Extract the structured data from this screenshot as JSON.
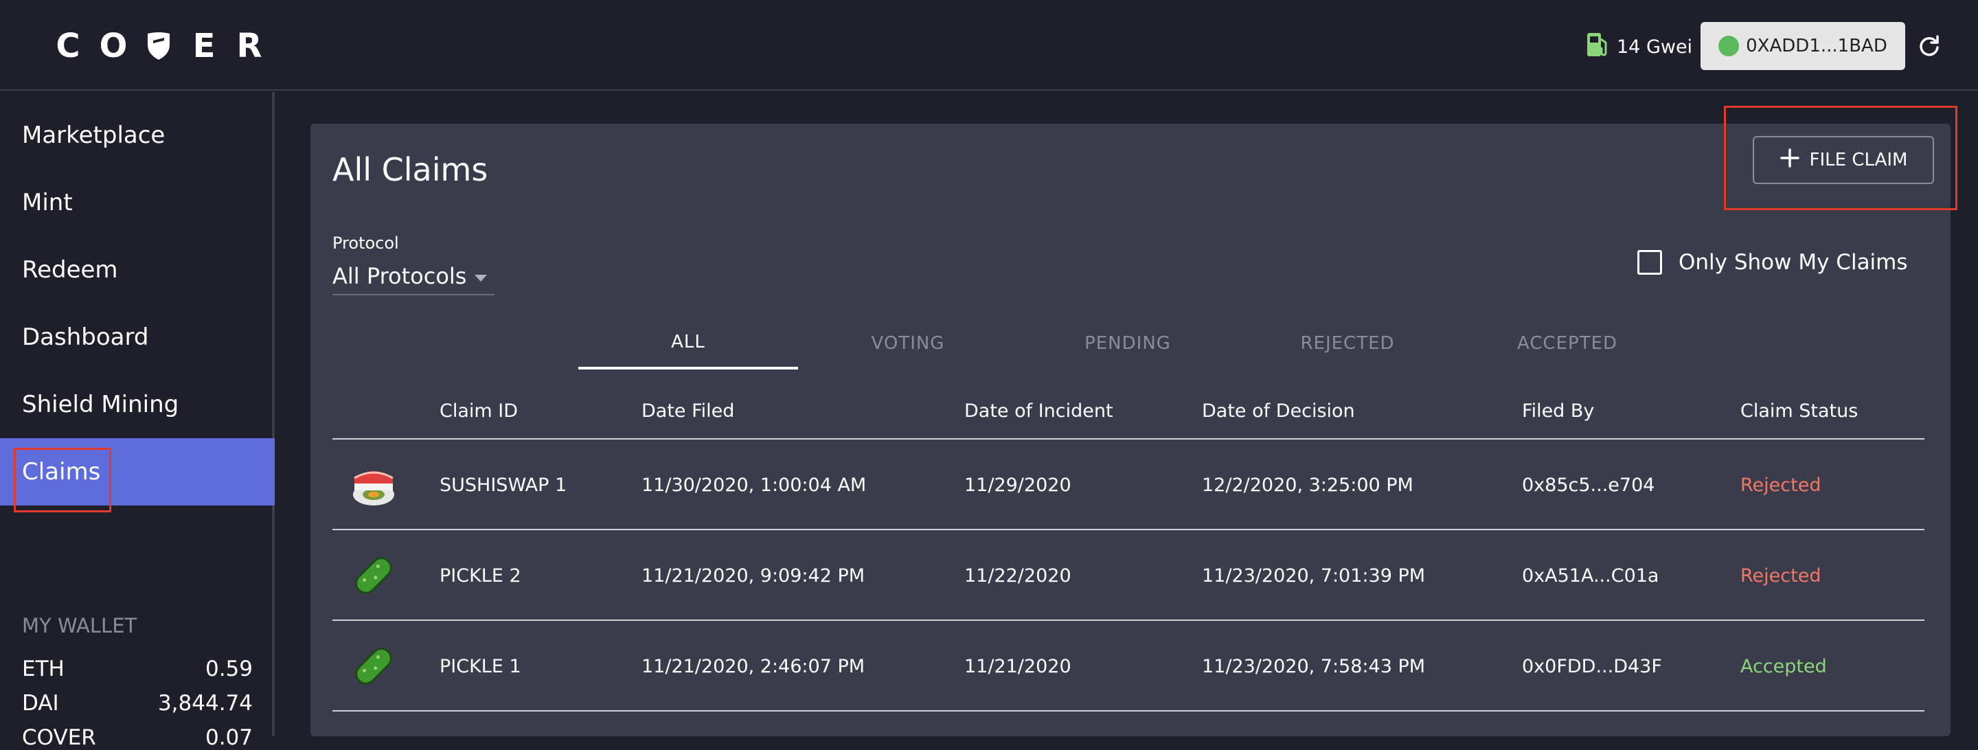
{
  "header": {
    "logo_letters": [
      "C",
      "O",
      "E",
      "R"
    ],
    "gas_value": "14 Gwei",
    "wallet_address": "0XADD1...1BAD"
  },
  "sidebar": {
    "items": [
      {
        "label": "Marketplace"
      },
      {
        "label": "Mint"
      },
      {
        "label": "Redeem"
      },
      {
        "label": "Dashboard"
      },
      {
        "label": "Shield Mining"
      },
      {
        "label": "Claims",
        "active": true
      }
    ],
    "wallet": {
      "title": "MY WALLET",
      "balances": [
        {
          "token": "ETH",
          "amount": "0.59"
        },
        {
          "token": "DAI",
          "amount": "3,844.74"
        },
        {
          "token": "COVER",
          "amount": "0.07"
        }
      ]
    }
  },
  "main": {
    "title": "All Claims",
    "file_claim_label": "FILE CLAIM",
    "protocol_label": "Protocol",
    "protocol_value": "All Protocols",
    "only_mine_label": "Only Show My Claims",
    "tabs": [
      {
        "label": "ALL",
        "active": true
      },
      {
        "label": "VOTING"
      },
      {
        "label": "PENDING"
      },
      {
        "label": "REJECTED"
      },
      {
        "label": "ACCEPTED"
      }
    ],
    "columns": [
      "Claim ID",
      "Date Filed",
      "Date of Incident",
      "Date of Decision",
      "Filed By",
      "Claim Status"
    ],
    "rows": [
      {
        "icon": "sushi-icon",
        "claim_id": "SUSHISWAP 1",
        "date_filed": "11/30/2020, 1:00:04 AM",
        "date_incident": "11/29/2020",
        "date_decision": "12/2/2020, 3:25:00 PM",
        "filed_by": "0x85c5...e704",
        "status": "Rejected"
      },
      {
        "icon": "pickle-icon",
        "claim_id": "PICKLE 2",
        "date_filed": "11/21/2020, 9:09:42 PM",
        "date_incident": "11/22/2020",
        "date_decision": "11/23/2020, 7:01:39 PM",
        "filed_by": "0xA51A...C01a",
        "status": "Rejected"
      },
      {
        "icon": "pickle-icon",
        "claim_id": "PICKLE 1",
        "date_filed": "11/21/2020, 2:46:07 PM",
        "date_incident": "11/21/2020",
        "date_decision": "11/23/2020, 7:58:43 PM",
        "filed_by": "0x0FDD...D43F",
        "status": "Accepted"
      }
    ]
  },
  "colors": {
    "background": "#1e1f2b",
    "panel": "#3a3c4b",
    "active_nav": "#5e6ddb",
    "rejected": "#f07865",
    "accepted": "#8cd67a",
    "highlight": "#e03a2a"
  }
}
